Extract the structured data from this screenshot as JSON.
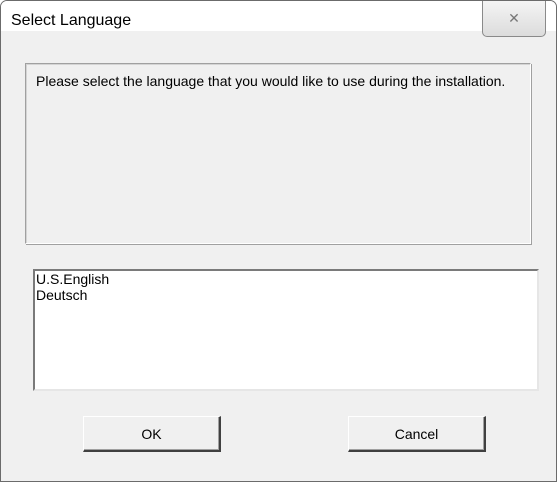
{
  "dialog": {
    "title": "Select Language",
    "close_glyph": "☒"
  },
  "message": "Please select the language that you would like to use during the installation.",
  "languages": [
    "U.S.English",
    "Deutsch"
  ],
  "buttons": {
    "ok_label": "OK",
    "cancel_label": "Cancel"
  }
}
